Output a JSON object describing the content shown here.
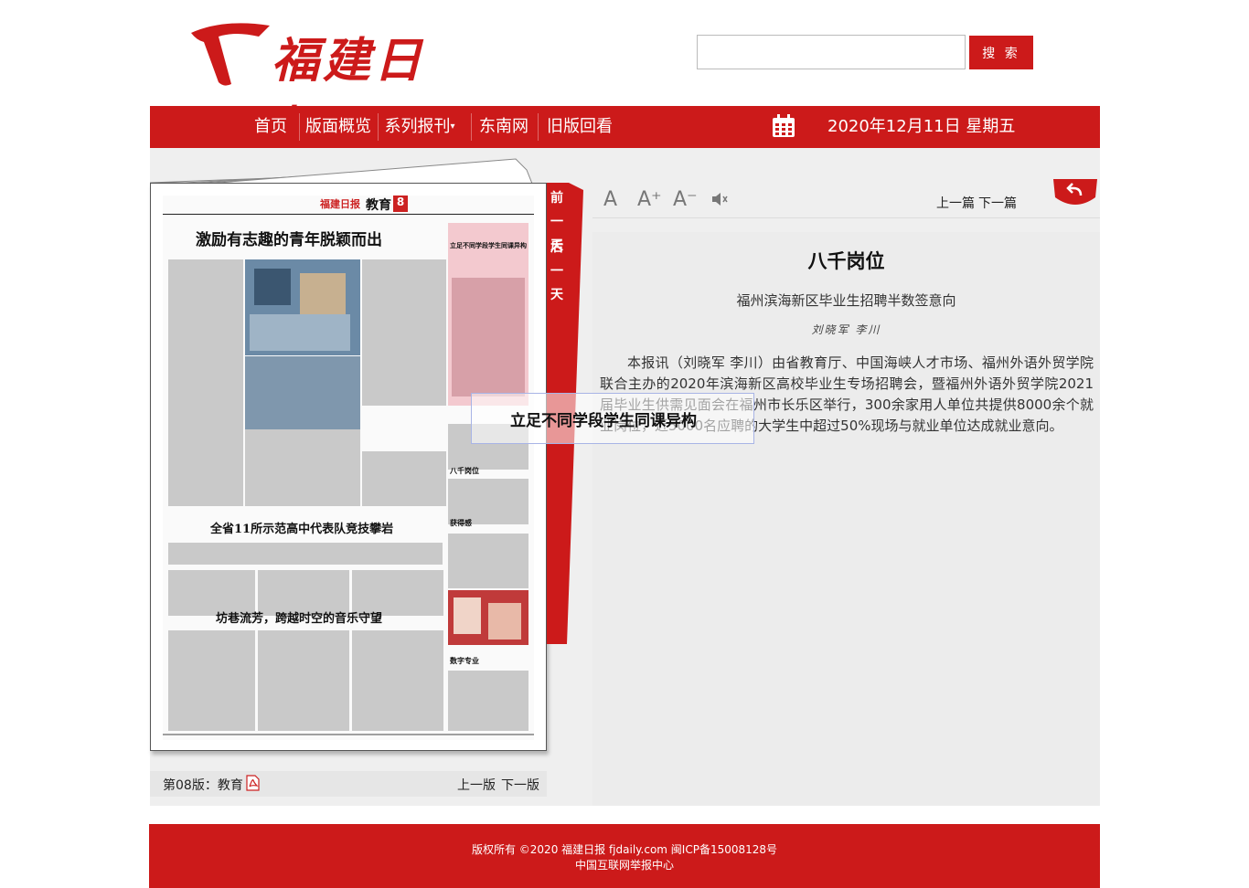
{
  "header": {
    "logo_text": "福建日報",
    "search": {
      "value": "",
      "button_label": "搜 索"
    }
  },
  "nav": {
    "items": [
      "首页",
      "版面概览",
      "系列报刊",
      "东南网",
      "旧版回看"
    ],
    "date": "2020年12月11日 星期五"
  },
  "colors": {
    "brand_red": "#cc1a1a",
    "panel_bg": "#ececec"
  },
  "ribbon": {
    "prev_day": "前一天",
    "next_day": "后一天"
  },
  "page": {
    "label": "第08版：教育",
    "prev": "上一版",
    "next": "下一版",
    "newspaper": {
      "masthead": "福建日报",
      "section": "教育",
      "page_no": "8",
      "headlines": [
        "激励有志趣的青年脱颖而出",
        "全省11所示范高中代表队竞技攀岩",
        "坊巷流芳，跨越时空的音乐守望",
        "立足不同学段学生同课异构",
        "八千岗位",
        "获得感",
        "数字专业"
      ]
    }
  },
  "toolbar": {
    "font_large": "A",
    "font_increase": "A⁺",
    "font_decrease": "A⁻",
    "prev_article": "上一篇",
    "next_article": "下一篇"
  },
  "article": {
    "title": "八千岗位",
    "subtitle": "福州滨海新区毕业生招聘半数签意向",
    "author": "刘晓军  李川",
    "body": "本报讯（刘晓军 李川）由省教育厅、中国海峡人才市场、福州外语外贸学院联合主办的2020年滨海新区高校毕业生专场招聘会，暨福州外语外贸学院2021届毕业生供需见面会在福州市长乐区举行，300余家用人单位共提供8000余个就业岗位，近5000名应聘的大学生中超过50%现场与就业单位达成就业意向。"
  },
  "tooltip": {
    "text": "立足不同学段学生同课异构"
  },
  "footer": {
    "copyright": "版权所有 ©2020 福建日报 fjdaily.com 闽ICP备15008128号",
    "report_center": "中国互联网举报中心"
  }
}
